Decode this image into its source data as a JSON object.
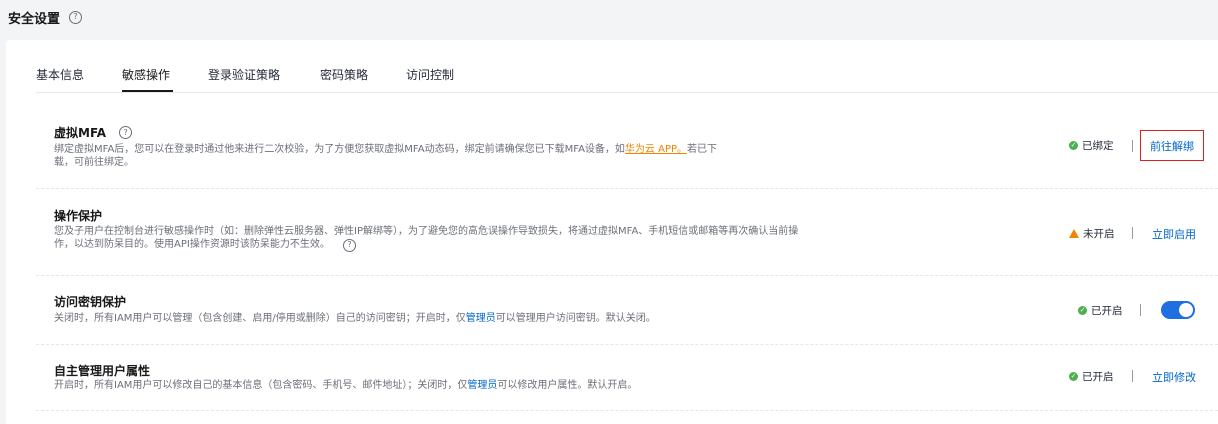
{
  "page": {
    "title": "安全设置"
  },
  "tabs": [
    {
      "label": "基本信息"
    },
    {
      "label": "敏感操作"
    },
    {
      "label": "登录验证策略"
    },
    {
      "label": "密码策略"
    },
    {
      "label": "访问控制"
    }
  ],
  "active_tab": "敏感操作",
  "sections": {
    "mfa": {
      "title": "虚拟MFA",
      "desc_line1_a": "绑定虚拟MFA后，您可以在登录时通过他来进行二次校验，为了方便您获取虚拟MFA动态码，绑定前请确保您已下载MFA设备，如",
      "desc_link": "华为云 APP。",
      "desc_line1_b": "若已下",
      "desc_line2": "载，可前往绑定。",
      "status": "已绑定",
      "action": "前往解绑"
    },
    "op_protect": {
      "title": "操作保护",
      "desc_line1": "您及子用户在控制台进行敏感操作时（如：删除弹性云服务器、弹性IP解绑等），为了避免您的高危误操作导致损失，将通过虚拟MFA、手机短信或邮箱等再次确认当前操",
      "desc_line2": "作，以达到防呆目的。使用API操作资源时该防呆能力不生效。",
      "status": "未开启",
      "action": "立即启用"
    },
    "access_key": {
      "title": "访问密钥保护",
      "desc_a": "关闭时，所有IAM用户可以管理（包含创建、启用/停用或删除）自己的访问密钥；开启时，仅",
      "desc_link": "管理员",
      "desc_b": "可以管理用户访问密钥。默认关闭。",
      "status": "已开启",
      "toggle_on": true
    },
    "self_manage": {
      "title": "自主管理用户属性",
      "desc_a": "开启时，所有IAM用户可以修改自己的基本信息（包含密码、手机号、邮件地址）；关闭时，仅",
      "desc_link": "管理员",
      "desc_b": "可以修改用户属性。默认开启。",
      "status": "已开启",
      "action": "立即修改"
    }
  },
  "icons": {
    "help": "?",
    "check": "✓",
    "warn": "!"
  },
  "colors": {
    "link": "#0066cc",
    "ok": "#4caf50",
    "warn": "#f08400",
    "highlight_box": "#e02020",
    "toggle": "#1f6fe0"
  }
}
